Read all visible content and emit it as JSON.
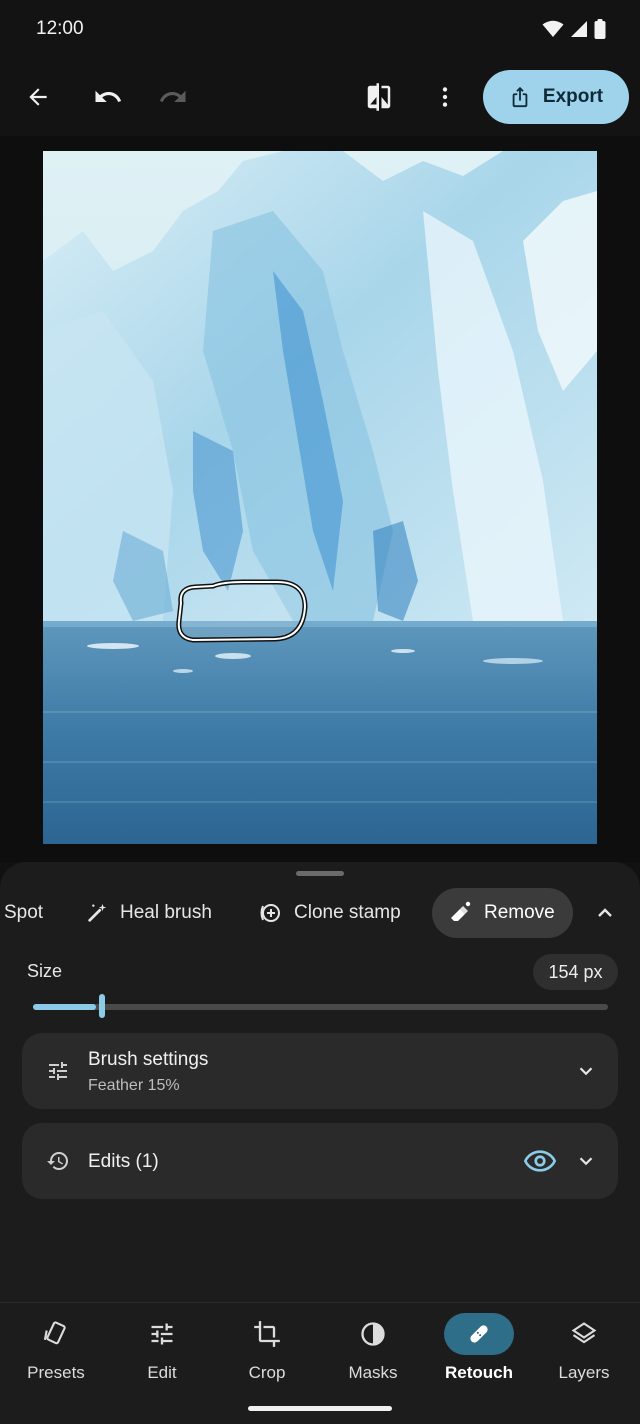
{
  "status_bar": {
    "time": "12:00",
    "icons": [
      "wifi-icon",
      "signal-icon",
      "battery-icon"
    ]
  },
  "toolbar": {
    "icons": [
      "back-arrow-icon",
      "undo-icon",
      "redo-icon",
      "compare-icon",
      "more-vert-icon"
    ],
    "export_label": "Export",
    "export_icon": "share-icon"
  },
  "image": {
    "subject": "glacier-and-water",
    "selection_outline": "remove-brush-stroke"
  },
  "retouch_tools": [
    {
      "label": "Spot",
      "icon": "spot-icon",
      "active": false
    },
    {
      "label": "Heal brush",
      "icon": "heal-brush-icon",
      "active": false
    },
    {
      "label": "Clone stamp",
      "icon": "clone-stamp-icon",
      "active": false
    },
    {
      "label": "Remove",
      "icon": "eraser-icon",
      "active": true
    }
  ],
  "size": {
    "label": "Size",
    "value_text": "154 px",
    "fraction": 0.12
  },
  "brush_settings": {
    "title": "Brush settings",
    "subtitle": "Feather 15%",
    "icon": "tune-icon"
  },
  "edits": {
    "title": "Edits (1)",
    "icon": "history-icon"
  },
  "nav": [
    {
      "label": "Presets",
      "icon": "presets-icon",
      "active": false
    },
    {
      "label": "Edit",
      "icon": "sliders-icon",
      "active": false
    },
    {
      "label": "Crop",
      "icon": "crop-icon",
      "active": false
    },
    {
      "label": "Masks",
      "icon": "masks-icon",
      "active": false
    },
    {
      "label": "Retouch",
      "icon": "bandage-icon",
      "active": true
    },
    {
      "label": "Layers",
      "icon": "layers-icon",
      "active": false
    }
  ],
  "colors": {
    "accent": "#9fd3ec",
    "nav_active": "#2f6e88",
    "slider": "#8ccbe8"
  }
}
